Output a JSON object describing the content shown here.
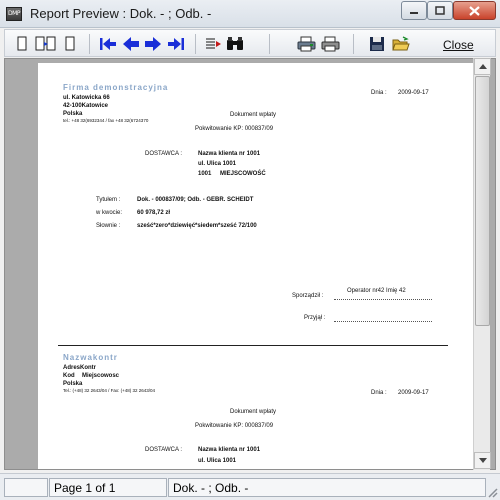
{
  "window": {
    "title": "Report Preview : Dok. - ; Odb. -",
    "app_icon_text": "DMP"
  },
  "toolbar": {
    "close_label": "Close"
  },
  "report": {
    "block1": {
      "company": "Firma demonstracyjna",
      "street": "ul. Katowicka 66",
      "city": "42-100Katowice",
      "country": "Polska",
      "contact": "tel.: +48 32(6932344 / fax +48 32(6724370",
      "date_label": "Dnia :",
      "date": "2009-09-17",
      "doc_title": "Dokument wpłaty",
      "doc_number": "Pokwitowanie KP:  000837/09",
      "supplier_label": "DOSTAWCA :",
      "supplier_name": "Nazwa klienta nr 1001",
      "supplier_street": "ul. Ulica 1001",
      "supplier_zip": "1001",
      "supplier_city": "MIEJSCOWOŚĆ",
      "title_label": "Tytułem :",
      "title_value": "Dok. - 000837/09; Odb. -  GEBR. SCHEIDT",
      "amount_label": "w kwocie:",
      "amount_value": "60 978,72 zł",
      "words_label": "Słownie :",
      "words_value": "sześć*zero*dziewięć*siedem*sześć  72/100",
      "prepared_label": "Sporządził :",
      "prepared_value": "Operator nr42 Imię 42",
      "received_label": "Przyjął :"
    },
    "block2": {
      "company": "Nazwakontr",
      "street": "AdresKontr",
      "code": "Kod",
      "city": "Miejscowosc",
      "country": "Polska",
      "contact": "Tel.: (+48) 32 2643/04 / Fax: (+48) 32 2643/04",
      "date_label": "Dnia :",
      "date": "2009-09-17",
      "doc_title": "Dokument wpłaty",
      "doc_number": "Pokwitowanie KP:  000837/09",
      "supplier_label": "DOSTAWCA :",
      "supplier_name": "Nazwa klienta nr 1001",
      "supplier_street": "ul. Ulica 1001"
    }
  },
  "status": {
    "page": "Page 1 of 1",
    "doc": "Dok. - ; Odb. -"
  },
  "colors": {
    "company": "#8aa6c8",
    "close_button": "#c9432b",
    "preview_bg": "#ababab"
  }
}
